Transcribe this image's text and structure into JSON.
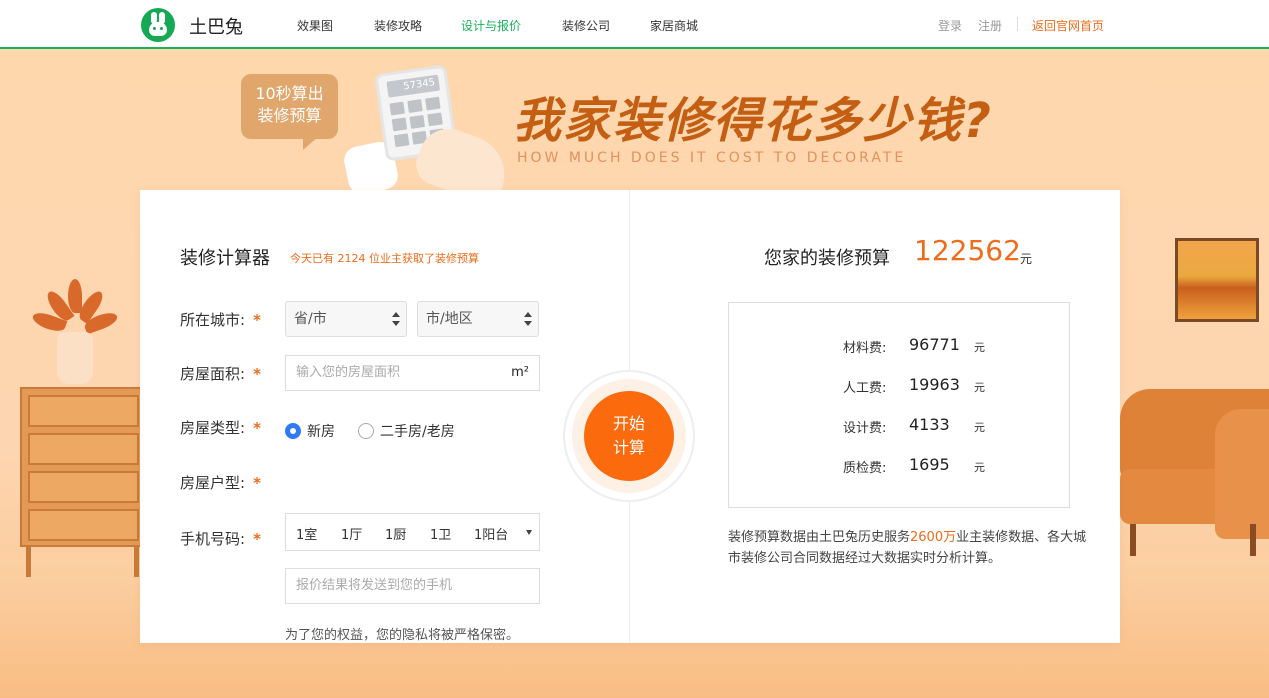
{
  "nav": {
    "brand": "土巴兔",
    "links": [
      {
        "label": "效果图",
        "active": false
      },
      {
        "label": "装修攻略",
        "active": false
      },
      {
        "label": "设计与报价",
        "active": true
      },
      {
        "label": "装修公司",
        "active": false
      },
      {
        "label": "家居商城",
        "active": false
      }
    ],
    "login": "登录",
    "register": "注册",
    "home": "返回官网首页"
  },
  "hero": {
    "bubble_line1": "10秒算出",
    "bubble_line2": "装修预算",
    "calculator_display": "57345",
    "headline": "我家装修得花多少钱?",
    "subheadline": "HOW MUCH DOES IT COST TO DECORATE"
  },
  "calculator": {
    "title": "装修计算器",
    "subtitle": "今天已有  2124  位业主获取了装修预算",
    "city_label": "所在城市:",
    "province_select": "省/市",
    "city_select": "市/地区",
    "area_label": "房屋面积:",
    "area_placeholder": "输入您的房屋面积",
    "area_unit": "m²",
    "type_label": "房屋类型:",
    "type_options": [
      {
        "label": "新房",
        "selected": true
      },
      {
        "label": "二手房/老房",
        "selected": false
      }
    ],
    "layout_label": "房屋户型:",
    "layout_values": [
      "1室",
      "1厅",
      "1厨",
      "1卫",
      "1阳台"
    ],
    "phone_label": "手机号码:",
    "phone_placeholder": "报价结果将发送到您的手机",
    "required_mark": "*",
    "privacy": "为了您的权益，您的隐私将被严格保密。",
    "start_line1": "开始",
    "start_line2": "计算"
  },
  "result": {
    "label": "您家的装修预算",
    "total": "122562",
    "unit": "元",
    "fees": [
      {
        "label": "材料费:",
        "value": "96771",
        "unit": "元"
      },
      {
        "label": "人工费:",
        "value": "19963",
        "unit": "元"
      },
      {
        "label": "设计费:",
        "value": "4133",
        "unit": "元"
      },
      {
        "label": "质检费:",
        "value": "1695",
        "unit": "元"
      }
    ],
    "note_part1": "装修预算数据由土巴兔历史服务",
    "note_highlight": "2600万",
    "note_part2": "业主装修数据、各大城市装修公司合同数据经过大数据实时分析计算。"
  },
  "colors": {
    "accent": "#f06b1a",
    "brand_green": "#18b25a",
    "start_button": "#fb6a0d",
    "headline": "#c45e12"
  }
}
